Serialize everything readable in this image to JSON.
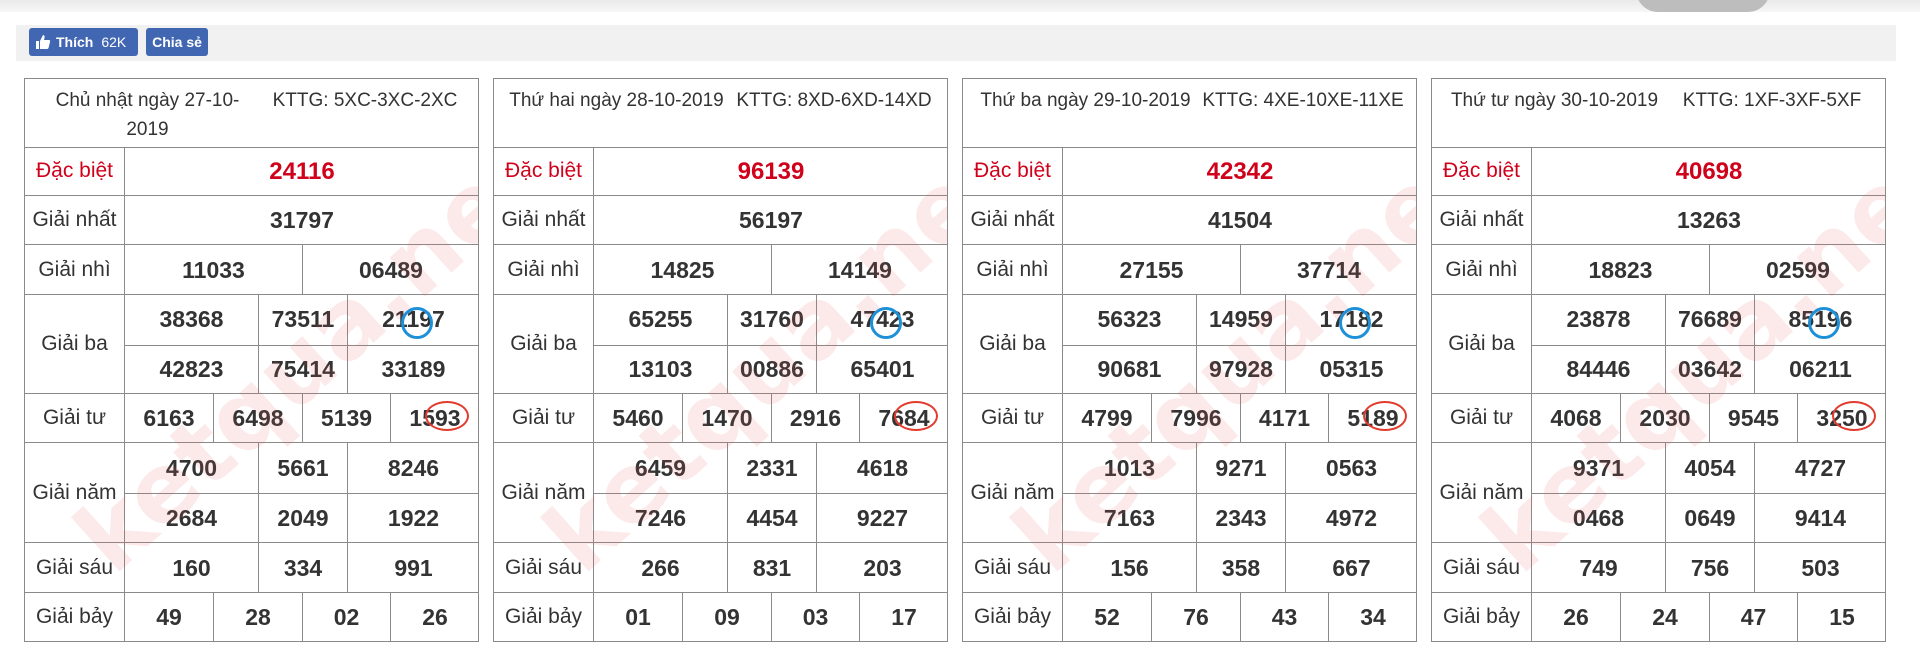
{
  "social": {
    "like_label": "Thích",
    "like_count": "62K",
    "share_label": "Chia sẻ"
  },
  "labels": {
    "db": "Đặc biệt",
    "g1": "Giải nhất",
    "g2": "Giải nhì",
    "g3": "Giải ba",
    "g4": "Giải tư",
    "g5": "Giải năm",
    "g6": "Giải sáu",
    "g7": "Giải bảy"
  },
  "watermark": "ketqua.net",
  "days": [
    {
      "date": "Chủ nhật ngày 27-10-2019",
      "kttg": "KTTG: 5XC-3XC-2XC",
      "db": "24116",
      "g1": "31797",
      "g2": [
        "11033",
        "06489"
      ],
      "g3": [
        "38368",
        "73511",
        "21197",
        "42823",
        "75414",
        "33189"
      ],
      "g4": [
        "6163",
        "6498",
        "5139",
        "1593"
      ],
      "g5": [
        "4700",
        "5661",
        "8246",
        "2684",
        "2049",
        "1922"
      ],
      "g6": [
        "160",
        "334",
        "991"
      ],
      "g7": [
        "49",
        "28",
        "02",
        "26"
      ]
    },
    {
      "date": "Thứ hai ngày 28-10-2019",
      "kttg": "KTTG: 8XD-6XD-14XD",
      "db": "96139",
      "g1": "56197",
      "g2": [
        "14825",
        "14149"
      ],
      "g3": [
        "65255",
        "31760",
        "47423",
        "13103",
        "00886",
        "65401"
      ],
      "g4": [
        "5460",
        "1470",
        "2916",
        "7684"
      ],
      "g5": [
        "6459",
        "2331",
        "4618",
        "7246",
        "4454",
        "9227"
      ],
      "g6": [
        "266",
        "831",
        "203"
      ],
      "g7": [
        "01",
        "09",
        "03",
        "17"
      ]
    },
    {
      "date": "Thứ ba ngày 29-10-2019",
      "kttg": "KTTG: 4XE-10XE-11XE",
      "db": "42342",
      "g1": "41504",
      "g2": [
        "27155",
        "37714"
      ],
      "g3": [
        "56323",
        "14959",
        "17182",
        "90681",
        "97928",
        "05315"
      ],
      "g4": [
        "4799",
        "7996",
        "4171",
        "5189"
      ],
      "g5": [
        "1013",
        "9271",
        "0563",
        "7163",
        "2343",
        "4972"
      ],
      "g6": [
        "156",
        "358",
        "667"
      ],
      "g7": [
        "52",
        "76",
        "43",
        "34"
      ]
    },
    {
      "date": "Thứ tư ngày 30-10-2019",
      "kttg": "KTTG: 1XF-3XF-5XF",
      "db": "40698",
      "g1": "13263",
      "g2": [
        "18823",
        "02599"
      ],
      "g3": [
        "23878",
        "76689",
        "85196",
        "84446",
        "03642",
        "06211"
      ],
      "g4": [
        "4068",
        "2030",
        "9545",
        "3250"
      ],
      "g5": [
        "9371",
        "4054",
        "4727",
        "0468",
        "0649",
        "9414"
      ],
      "g6": [
        "749",
        "756",
        "503"
      ],
      "g7": [
        "26",
        "24",
        "47",
        "15"
      ]
    }
  ]
}
